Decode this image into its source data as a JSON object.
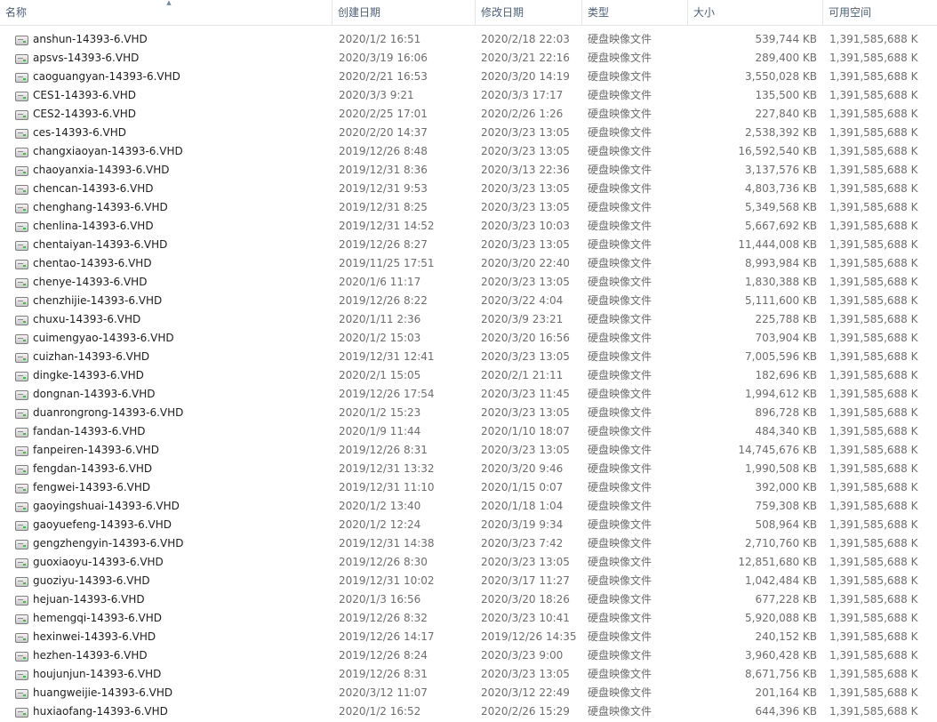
{
  "columns": {
    "name": "名称",
    "created": "创建日期",
    "modified": "修改日期",
    "type": "类型",
    "size": "大小",
    "free": "可用空间"
  },
  "rows": [
    {
      "name": "anshun-14393-6.VHD",
      "created": "2020/1/2 16:51",
      "modified": "2020/2/18 22:03",
      "type": "硬盘映像文件",
      "size": "539,744 KB",
      "free": "1,391,585,688 KB"
    },
    {
      "name": "apsvs-14393-6.VHD",
      "created": "2020/3/19 16:06",
      "modified": "2020/3/21 22:16",
      "type": "硬盘映像文件",
      "size": "289,400 KB",
      "free": "1,391,585,688 KB"
    },
    {
      "name": "caoguangyan-14393-6.VHD",
      "created": "2020/2/21 16:53",
      "modified": "2020/3/20 14:19",
      "type": "硬盘映像文件",
      "size": "3,550,028 KB",
      "free": "1,391,585,688 KB"
    },
    {
      "name": "CES1-14393-6.VHD",
      "created": "2020/3/3 9:21",
      "modified": "2020/3/3 17:17",
      "type": "硬盘映像文件",
      "size": "135,500 KB",
      "free": "1,391,585,688 KB"
    },
    {
      "name": "CES2-14393-6.VHD",
      "created": "2020/2/25 17:01",
      "modified": "2020/2/26 1:26",
      "type": "硬盘映像文件",
      "size": "227,840 KB",
      "free": "1,391,585,688 KB"
    },
    {
      "name": "ces-14393-6.VHD",
      "created": "2020/2/20 14:37",
      "modified": "2020/3/23 13:05",
      "type": "硬盘映像文件",
      "size": "2,538,392 KB",
      "free": "1,391,585,688 KB"
    },
    {
      "name": "changxiaoyan-14393-6.VHD",
      "created": "2019/12/26 8:48",
      "modified": "2020/3/23 13:05",
      "type": "硬盘映像文件",
      "size": "16,592,540 KB",
      "free": "1,391,585,688 KB"
    },
    {
      "name": "chaoyanxia-14393-6.VHD",
      "created": "2019/12/31 8:36",
      "modified": "2020/3/13 22:36",
      "type": "硬盘映像文件",
      "size": "3,137,576 KB",
      "free": "1,391,585,688 KB"
    },
    {
      "name": "chencan-14393-6.VHD",
      "created": "2019/12/31 9:53",
      "modified": "2020/3/23 13:05",
      "type": "硬盘映像文件",
      "size": "4,803,736 KB",
      "free": "1,391,585,688 KB"
    },
    {
      "name": "chenghang-14393-6.VHD",
      "created": "2019/12/31 8:25",
      "modified": "2020/3/23 13:05",
      "type": "硬盘映像文件",
      "size": "5,349,568 KB",
      "free": "1,391,585,688 KB"
    },
    {
      "name": "chenlina-14393-6.VHD",
      "created": "2019/12/31 14:52",
      "modified": "2020/3/23 10:03",
      "type": "硬盘映像文件",
      "size": "5,667,692 KB",
      "free": "1,391,585,688 KB"
    },
    {
      "name": "chentaiyan-14393-6.VHD",
      "created": "2019/12/26 8:27",
      "modified": "2020/3/23 13:05",
      "type": "硬盘映像文件",
      "size": "11,444,008 KB",
      "free": "1,391,585,688 KB"
    },
    {
      "name": "chentao-14393-6.VHD",
      "created": "2019/11/25 17:51",
      "modified": "2020/3/20 22:40",
      "type": "硬盘映像文件",
      "size": "8,993,984 KB",
      "free": "1,391,585,688 KB"
    },
    {
      "name": "chenye-14393-6.VHD",
      "created": "2020/1/6 11:17",
      "modified": "2020/3/23 13:05",
      "type": "硬盘映像文件",
      "size": "1,830,388 KB",
      "free": "1,391,585,688 KB"
    },
    {
      "name": "chenzhijie-14393-6.VHD",
      "created": "2019/12/26 8:22",
      "modified": "2020/3/22 4:04",
      "type": "硬盘映像文件",
      "size": "5,111,600 KB",
      "free": "1,391,585,688 KB"
    },
    {
      "name": "chuxu-14393-6.VHD",
      "created": "2020/1/11 2:36",
      "modified": "2020/3/9 23:21",
      "type": "硬盘映像文件",
      "size": "225,788 KB",
      "free": "1,391,585,688 KB"
    },
    {
      "name": "cuimengyao-14393-6.VHD",
      "created": "2020/1/2 15:03",
      "modified": "2020/3/20 16:56",
      "type": "硬盘映像文件",
      "size": "703,904 KB",
      "free": "1,391,585,688 KB"
    },
    {
      "name": "cuizhan-14393-6.VHD",
      "created": "2019/12/31 12:41",
      "modified": "2020/3/23 13:05",
      "type": "硬盘映像文件",
      "size": "7,005,596 KB",
      "free": "1,391,585,688 KB"
    },
    {
      "name": "dingke-14393-6.VHD",
      "created": "2020/2/1 15:05",
      "modified": "2020/2/1 21:11",
      "type": "硬盘映像文件",
      "size": "182,696 KB",
      "free": "1,391,585,688 KB"
    },
    {
      "name": "dongnan-14393-6.VHD",
      "created": "2019/12/26 17:54",
      "modified": "2020/3/23 11:45",
      "type": "硬盘映像文件",
      "size": "1,994,612 KB",
      "free": "1,391,585,688 KB"
    },
    {
      "name": "duanrongrong-14393-6.VHD",
      "created": "2020/1/2 15:23",
      "modified": "2020/3/23 13:05",
      "type": "硬盘映像文件",
      "size": "896,728 KB",
      "free": "1,391,585,688 KB"
    },
    {
      "name": "fandan-14393-6.VHD",
      "created": "2020/1/9 11:44",
      "modified": "2020/1/10 18:07",
      "type": "硬盘映像文件",
      "size": "484,340 KB",
      "free": "1,391,585,688 KB"
    },
    {
      "name": "fanpeiren-14393-6.VHD",
      "created": "2019/12/26 8:31",
      "modified": "2020/3/23 13:05",
      "type": "硬盘映像文件",
      "size": "14,745,676 KB",
      "free": "1,391,585,688 KB"
    },
    {
      "name": "fengdan-14393-6.VHD",
      "created": "2019/12/31 13:32",
      "modified": "2020/3/20 9:46",
      "type": "硬盘映像文件",
      "size": "1,990,508 KB",
      "free": "1,391,585,688 KB"
    },
    {
      "name": "fengwei-14393-6.VHD",
      "created": "2019/12/31 11:10",
      "modified": "2020/1/15 0:07",
      "type": "硬盘映像文件",
      "size": "392,000 KB",
      "free": "1,391,585,688 KB"
    },
    {
      "name": "gaoyingshuai-14393-6.VHD",
      "created": "2020/1/2 13:40",
      "modified": "2020/1/18 1:04",
      "type": "硬盘映像文件",
      "size": "759,308 KB",
      "free": "1,391,585,688 KB"
    },
    {
      "name": "gaoyuefeng-14393-6.VHD",
      "created": "2020/1/2 12:24",
      "modified": "2020/3/19 9:34",
      "type": "硬盘映像文件",
      "size": "508,964 KB",
      "free": "1,391,585,688 KB"
    },
    {
      "name": "gengzhengyin-14393-6.VHD",
      "created": "2019/12/31 14:38",
      "modified": "2020/3/23 7:42",
      "type": "硬盘映像文件",
      "size": "2,710,760 KB",
      "free": "1,391,585,688 KB"
    },
    {
      "name": "guoxiaoyu-14393-6.VHD",
      "created": "2019/12/26 8:30",
      "modified": "2020/3/23 13:05",
      "type": "硬盘映像文件",
      "size": "12,851,680 KB",
      "free": "1,391,585,688 KB"
    },
    {
      "name": "guoziyu-14393-6.VHD",
      "created": "2019/12/31 10:02",
      "modified": "2020/3/17 11:27",
      "type": "硬盘映像文件",
      "size": "1,042,484 KB",
      "free": "1,391,585,688 KB"
    },
    {
      "name": "hejuan-14393-6.VHD",
      "created": "2020/1/3 16:56",
      "modified": "2020/3/20 18:26",
      "type": "硬盘映像文件",
      "size": "677,228 KB",
      "free": "1,391,585,688 KB"
    },
    {
      "name": "hemengqi-14393-6.VHD",
      "created": "2019/12/26 8:32",
      "modified": "2020/3/23 10:41",
      "type": "硬盘映像文件",
      "size": "5,920,088 KB",
      "free": "1,391,585,688 KB"
    },
    {
      "name": "hexinwei-14393-6.VHD",
      "created": "2019/12/26 14:17",
      "modified": "2019/12/26 14:35",
      "type": "硬盘映像文件",
      "size": "240,152 KB",
      "free": "1,391,585,688 KB"
    },
    {
      "name": "hezhen-14393-6.VHD",
      "created": "2019/12/26 8:24",
      "modified": "2020/3/23 9:00",
      "type": "硬盘映像文件",
      "size": "3,960,428 KB",
      "free": "1,391,585,688 KB"
    },
    {
      "name": "houjunjun-14393-6.VHD",
      "created": "2019/12/26 8:31",
      "modified": "2020/3/23 13:05",
      "type": "硬盘映像文件",
      "size": "8,671,756 KB",
      "free": "1,391,585,688 KB"
    },
    {
      "name": "huangweijie-14393-6.VHD",
      "created": "2020/3/12 11:07",
      "modified": "2020/3/12 22:49",
      "type": "硬盘映像文件",
      "size": "201,164 KB",
      "free": "1,391,585,688 KB"
    },
    {
      "name": "huxiaofang-14393-6.VHD",
      "created": "2020/1/2 16:52",
      "modified": "2020/2/26 15:29",
      "type": "硬盘映像文件",
      "size": "644,396 KB",
      "free": "1,391,585,688 KB"
    }
  ],
  "icons": {
    "file": "vhd-disk-icon",
    "sort": "sort-ascending-icon"
  },
  "colors": {
    "header_text": "#4c607a",
    "detail_text": "#6d6d6d",
    "name_text": "#1e1e1e"
  }
}
